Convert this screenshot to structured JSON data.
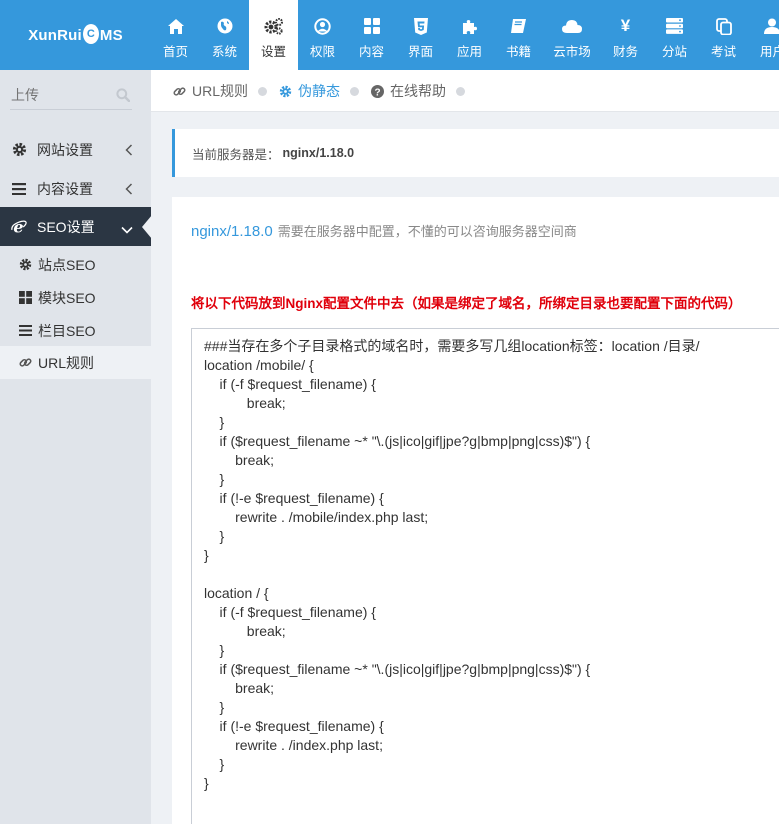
{
  "brand": {
    "name_part1": "XunRui",
    "drop_letter": "C",
    "name_part2": "MS"
  },
  "nav": [
    {
      "label": "首页",
      "icon": "home-icon"
    },
    {
      "label": "系统",
      "icon": "globe-icon"
    },
    {
      "label": "设置",
      "icon": "cogs-icon",
      "active": true
    },
    {
      "label": "权限",
      "icon": "user-circle-icon"
    },
    {
      "label": "内容",
      "icon": "grid-icon"
    },
    {
      "label": "界面",
      "icon": "html5-icon"
    },
    {
      "label": "应用",
      "icon": "puzzle-icon"
    },
    {
      "label": "书籍",
      "icon": "book-icon"
    },
    {
      "label": "云市场",
      "icon": "cloud-icon"
    },
    {
      "label": "财务",
      "icon": "yen-icon"
    },
    {
      "label": "分站",
      "icon": "server-icon"
    },
    {
      "label": "考试",
      "icon": "copy-icon"
    },
    {
      "label": "用户",
      "icon": "user-icon"
    }
  ],
  "sidebar": {
    "search_placeholder": "上传",
    "items": [
      {
        "label": "网站设置",
        "icon": "cog-icon"
      },
      {
        "label": "内容设置",
        "icon": "bars-icon"
      },
      {
        "label": "SEO设置",
        "icon": "ie-icon",
        "active": true
      }
    ],
    "subitems": [
      {
        "label": "站点SEO",
        "icon": "cog-icon"
      },
      {
        "label": "模块SEO",
        "icon": "th-large-icon"
      },
      {
        "label": "栏目SEO",
        "icon": "list-icon"
      },
      {
        "label": "URL规则",
        "icon": "link-icon",
        "current": true
      }
    ]
  },
  "tabs": [
    {
      "label": "URL规则",
      "icon": "link-icon"
    },
    {
      "label": "伪静态",
      "icon": "cog-icon",
      "active": true
    },
    {
      "label": "在线帮助",
      "icon": "question-circle-icon"
    }
  ],
  "server_note": {
    "prefix": "当前服务器是：",
    "server": "nginx/1.18.0"
  },
  "panel": {
    "version": "nginx/1.18.0",
    "description": "需要在服务器中配置，不懂的可以咨询服务器空间商",
    "warning": "将以下代码放到Nginx配置文件中去（如果是绑定了域名，所绑定目录也要配置下面的代码）",
    "code": "###当存在多个子目录格式的域名时，需要多写几组location标签：location /目录/\nlocation /mobile/ {\n    if (-f $request_filename) {\n           break;\n    }\n    if ($request_filename ~* \"\\.(js|ico|gif|jpe?g|bmp|png|css)$\") {\n        break;\n    }\n    if (!-e $request_filename) {\n        rewrite . /mobile/index.php last;\n    }\n}\n\nlocation / {\n    if (-f $request_filename) {\n           break;\n    }\n    if ($request_filename ~* \"\\.(js|ico|gif|jpe?g|bmp|png|css)$\") {\n        break;\n    }\n    if (!-e $request_filename) {\n        rewrite . /index.php last;\n    }\n}"
  }
}
